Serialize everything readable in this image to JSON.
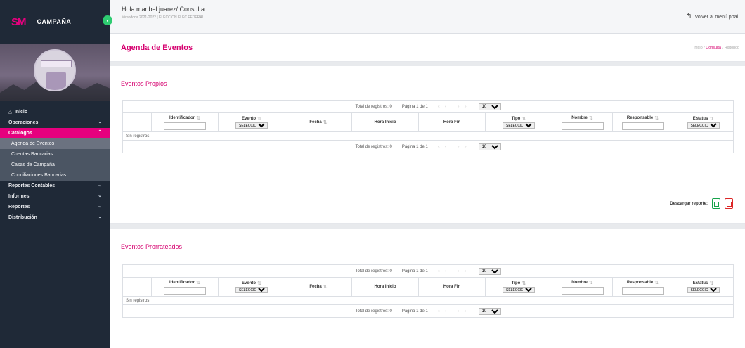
{
  "brand": {
    "logo": "SM",
    "name": "CAMPAÑA",
    "collapse_glyph": "‹"
  },
  "sidebar": {
    "home": "Inicio",
    "items": [
      {
        "label": "Operaciones",
        "chevron": "⌄"
      },
      {
        "label": "Catálogos",
        "chevron": "⌃"
      }
    ],
    "sub_items": [
      "Agenda de Eventos",
      "Cuentas Bancarias",
      "Casas de Campaña",
      "Conciliaciones Bancarias"
    ],
    "more_items": [
      {
        "label": "Reportes Contables",
        "chevron": "⌄"
      },
      {
        "label": "Informes",
        "chevron": "⌄"
      },
      {
        "label": "Reportes",
        "chevron": "⌄"
      },
      {
        "label": "Distribución",
        "chevron": "⌄"
      }
    ]
  },
  "topbar": {
    "greeting": "Hola maribel.juarez/ Consulta",
    "subtitle": "Mirandona 2021-2022 | ELECCIÓN ELEC FEDERAL",
    "back_label": "Volver al menú ppal."
  },
  "header": {
    "title": "Agenda de Eventos",
    "crumb_1": "Inicio",
    "crumb_sep_1": " / ",
    "crumb_2": "Consulta",
    "crumb_sep_2": " / ",
    "crumb_3": "Histórico"
  },
  "pager": {
    "total": "Total de registros: 0",
    "page": "Página 1 de 1",
    "nav_prev": "« ‹",
    "nav_next": "› »",
    "page_size": "10"
  },
  "columns": {
    "identificador": "Identificador",
    "evento": "Evento",
    "fecha": "Fecha",
    "hora_inicio": "Hora Inicio",
    "hora_fin": "Hora Fin",
    "tipo": "Tipo",
    "nombre": "Nombre",
    "responsable": "Responsable",
    "estatus": "Estatus",
    "select_default": "SELECCIONA"
  },
  "sections": {
    "propios": {
      "title": "Eventos Propios",
      "empty": "Sin registros"
    },
    "prorrateados": {
      "title": "Eventos Prorrateados",
      "empty": "Sin registros"
    }
  },
  "download": {
    "label": "Descargar reporte:"
  },
  "icons": {
    "sort": "⇅",
    "home": "⌂",
    "back": "↰"
  },
  "colors": {
    "accent": "#d6006f",
    "sidebar_bg": "#1f2937",
    "active_nav": "#e6007e",
    "excel": "#16a34a",
    "pdf": "#dc2626"
  }
}
